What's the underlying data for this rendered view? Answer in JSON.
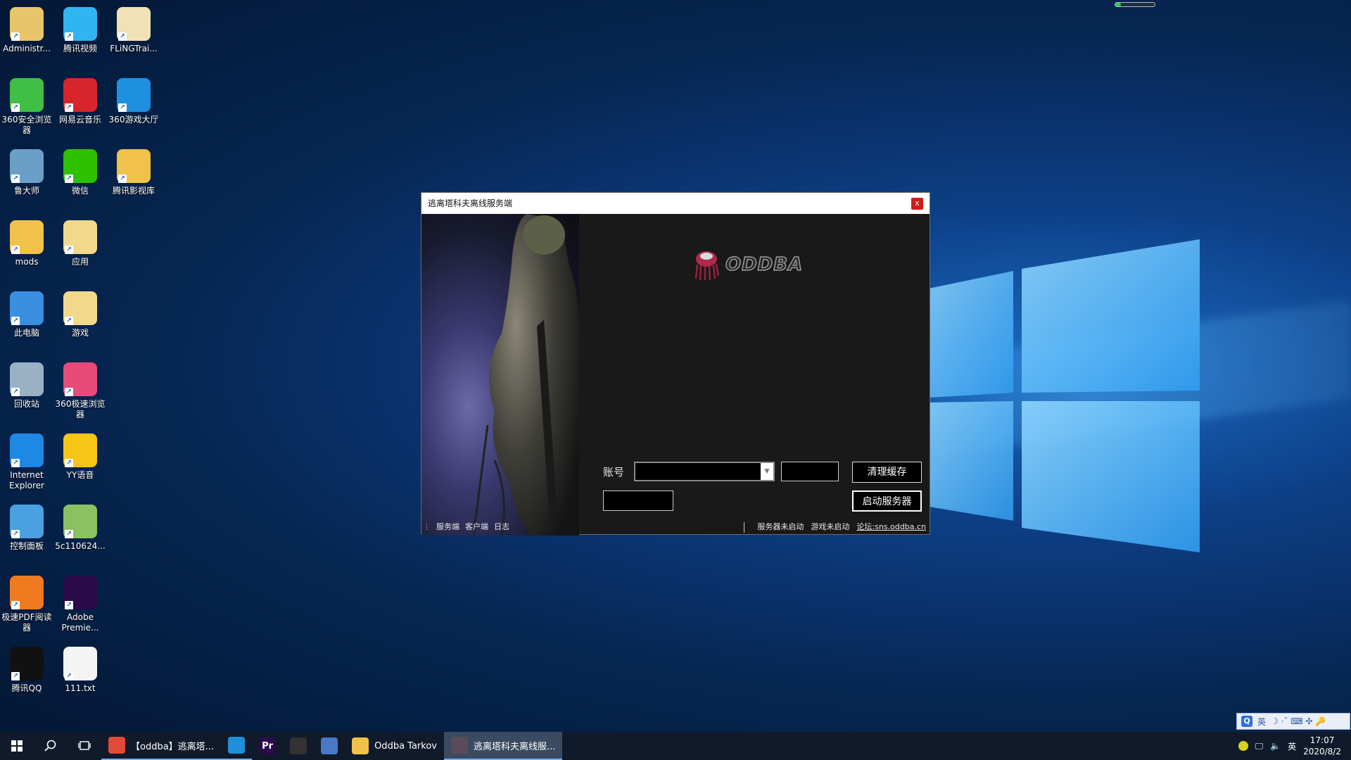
{
  "desktop": {
    "icons": [
      {
        "label": "Administr...",
        "icon": "user-folder-icon",
        "color": "#e8c46a"
      },
      {
        "label": "腾讯视频",
        "icon": "tencent-video-icon",
        "color": "#2fb5f0"
      },
      {
        "label": "FLiNGTrai...",
        "icon": "document-folder-icon",
        "color": "#f0e2b4"
      },
      {
        "label": "360安全浏览器",
        "icon": "360-browser-icon",
        "color": "#3fbf45"
      },
      {
        "label": "网易云音乐",
        "icon": "netease-music-icon",
        "color": "#d8252b"
      },
      {
        "label": "360游戏大厅",
        "icon": "360-game-icon",
        "color": "#1f8fe0"
      },
      {
        "label": "鲁大师",
        "icon": "ludashi-icon",
        "color": "#6aa0c8"
      },
      {
        "label": "微信",
        "icon": "wechat-icon",
        "color": "#2dc100"
      },
      {
        "label": "腾讯影视库",
        "icon": "folder-icon",
        "color": "#f0c24a"
      },
      {
        "label": "mods",
        "icon": "folder-icon",
        "color": "#f0c24a"
      },
      {
        "label": "应用",
        "icon": "app-folder-icon",
        "color": "#f0d98a"
      },
      {
        "label": "此电脑",
        "icon": "computer-icon",
        "color": "#3a8fe0"
      },
      {
        "label": "游戏",
        "icon": "game-folder-icon",
        "color": "#f0d98a"
      },
      {
        "label": "回收站",
        "icon": "recycle-bin-icon",
        "color": "#9ab0c4"
      },
      {
        "label": "360极速浏览器",
        "icon": "360-speed-browser-icon",
        "color": "#e84a7a"
      },
      {
        "label": "Internet Explorer",
        "icon": "ie-icon",
        "color": "#1e88e5"
      },
      {
        "label": "YY语音",
        "icon": "yy-icon",
        "color": "#f5c518"
      },
      {
        "label": "控制面板",
        "icon": "control-panel-icon",
        "color": "#4aa0e0"
      },
      {
        "label": "5c110624...",
        "icon": "image-file-icon",
        "color": "#8cc060"
      },
      {
        "label": "极速PDF阅读器",
        "icon": "pdf-reader-icon",
        "color": "#f07a20"
      },
      {
        "label": "Adobe Premie...",
        "icon": "premiere-icon",
        "color": "#2a0a4a"
      },
      {
        "label": "腾讯QQ",
        "icon": "qq-icon",
        "color": "#111111"
      },
      {
        "label": "111.txt",
        "icon": "text-file-icon",
        "color": "#f4f4f4"
      }
    ]
  },
  "top_progress": {
    "fraction": 0.15
  },
  "window": {
    "title": "逃离塔科夫离线服务端",
    "close": "x",
    "logo_text": "ODDBA",
    "account_label": "账号",
    "account_value": "",
    "clear_cache_button": "清理缓存",
    "start_server_button": "启动服务器",
    "tabs": [
      "服务端",
      "客户端",
      "日志"
    ],
    "status": {
      "server": "服务器未启动",
      "game": "游戏未启动",
      "forum": "论坛:sns.oddba.cn"
    }
  },
  "ime": {
    "q": "Q",
    "lang": "英",
    "extras": "☽ ·ˇ ⌨ ✣ 🔑"
  },
  "taskbar": {
    "apps": [
      {
        "label": "【oddba】逃离塔...",
        "icon": "chrome-icon",
        "color": "#e04a3a",
        "state": "pinned"
      },
      {
        "label": "",
        "icon": "edge-icon",
        "color": "#1e8fd8",
        "state": "pinned"
      },
      {
        "label": "Pr",
        "icon": "premiere-icon",
        "color": "#2a0a4a",
        "state": "plain"
      },
      {
        "label": "",
        "icon": "tarkov-icon",
        "color": "#333333",
        "state": "plain"
      },
      {
        "label": "",
        "icon": "arrow-app-icon",
        "color": "#4a78c8",
        "state": "plain"
      },
      {
        "label": "Oddba Tarkov",
        "icon": "folder-icon",
        "color": "#f0c24a",
        "state": "plain"
      },
      {
        "label": "逃离塔科夫离线服...",
        "icon": "tarkov-server-icon",
        "color": "#5a4a5a",
        "state": "active"
      }
    ],
    "tray": {
      "lang": "英",
      "time": "17:07",
      "date": "2020/8/2"
    }
  }
}
